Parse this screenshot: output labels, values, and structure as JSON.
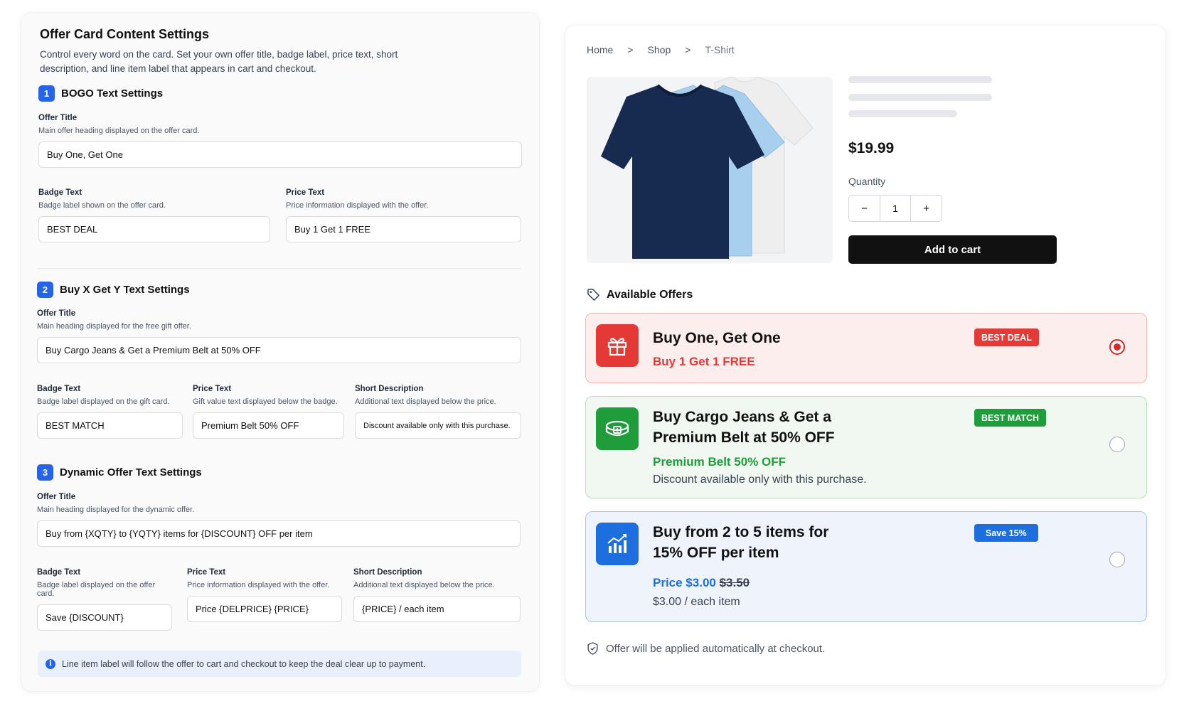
{
  "settings": {
    "title": "Offer Card Content Settings",
    "description": "Control every word on the card. Set your own offer title, badge label, price text, short description, and line item label that appears in cart and checkout.",
    "bogo": {
      "number": "1",
      "heading": "BOGO Text Settings",
      "offer_title_label": "Offer Title",
      "offer_title_help": "Main offer heading displayed on the offer card.",
      "offer_title_value": "Buy One, Get One",
      "badge_label": "Badge Text",
      "badge_help": "Badge label shown on the offer card.",
      "badge_value": "BEST DEAL",
      "price_label": "Price Text",
      "price_help": "Price information displayed with the offer.",
      "price_value": "Buy 1 Get 1 FREE"
    },
    "bxgy": {
      "number": "2",
      "heading": "Buy X Get Y Text Settings",
      "offer_title_label": "Offer Title",
      "offer_title_help": "Main heading displayed for the free gift offer.",
      "offer_title_value": "Buy Cargo Jeans & Get a Premium Belt at 50% OFF",
      "badge_label": "Badge Text",
      "badge_help": "Badge label displayed on the gift card.",
      "badge_value": "BEST MATCH",
      "price_label": "Price Text",
      "price_help": "Gift value text displayed below the badge.",
      "price_value": "Premium Belt 50% OFF",
      "desc_label": "Short Description",
      "desc_help": "Additional text displayed below the price.",
      "desc_value": "Discount available only with this purchase."
    },
    "dynamic": {
      "number": "3",
      "heading": "Dynamic Offer Text Settings",
      "offer_title_label": "Offer Title",
      "offer_title_help": "Main heading displayed for the dynamic offer.",
      "offer_title_value": "Buy from {XQTY} to {YQTY} items for {DISCOUNT} OFF per item",
      "badge_label": "Badge Text",
      "badge_help": "Badge label displayed on the offer card.",
      "badge_value": "Save {DISCOUNT}",
      "price_label": "Price Text",
      "price_help": "Price information displayed with the offer.",
      "price_value": "Price {DELPRICE} {PRICE}",
      "desc_label": "Short Description",
      "desc_help": "Additional text displayed below the price.",
      "desc_value": "{PRICE} / each item"
    },
    "info_icon": "info-icon",
    "info_text": "Line item label will follow the offer to cart and checkout to keep the deal clear up to payment."
  },
  "preview": {
    "breadcrumb": [
      "Home",
      ">",
      "Shop",
      ">",
      "T-Shirt"
    ],
    "product_image": "t-shirts-image",
    "price": "$19.99",
    "quantity_label": "Quantity",
    "quantity_minus": "−",
    "quantity_value": "1",
    "quantity_plus": "+",
    "add_to_cart": "Add to cart",
    "offers_heading": "Available Offers",
    "offers": [
      {
        "icon": "gift-icon",
        "title": "Buy One, Get One",
        "badge": "BEST DEAL",
        "price_text": "Buy 1 Get 1 FREE",
        "selected": true,
        "color": "#e53935"
      },
      {
        "icon": "belt-icon",
        "title_line1": "Buy Cargo Jeans & Get a",
        "title_line2": "Premium Belt at 50% OFF",
        "badge": "BEST MATCH",
        "price_text": "Premium Belt 50% OFF",
        "description": "Discount available only with this purchase.",
        "selected": false,
        "color": "#1f9d3a"
      },
      {
        "icon": "chart-growth-icon",
        "title_line1": "Buy from 2 to 5 items for",
        "title_line2": "15% OFF per item",
        "badge": "Save 15%",
        "price_label": "Price $3.00",
        "old_price": "$3.50",
        "description": "$3.00 / each item",
        "selected": false,
        "color": "#1d6fe0"
      }
    ],
    "footer_note": "Offer will be applied automatically at checkout."
  }
}
